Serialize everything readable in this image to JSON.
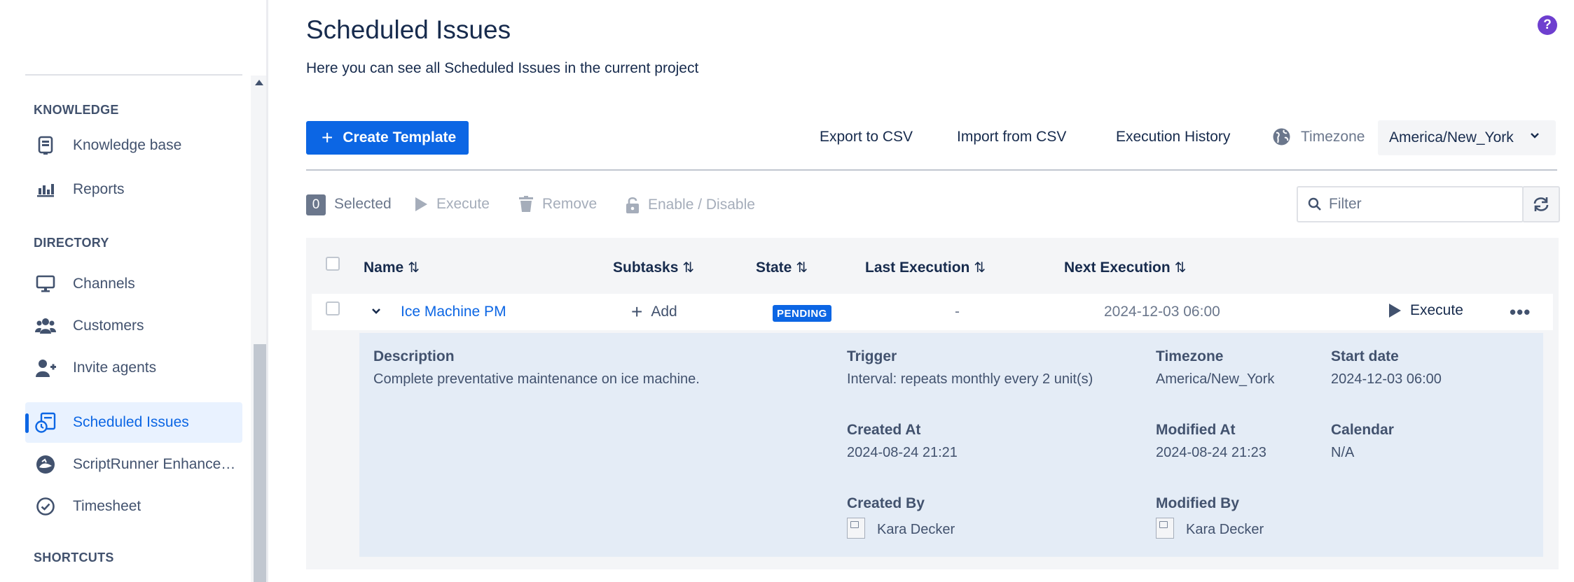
{
  "sidebar": {
    "sections": [
      {
        "heading": "KNOWLEDGE"
      },
      {
        "heading": "DIRECTORY"
      },
      {
        "heading": "SHORTCUTS"
      }
    ],
    "items": [
      {
        "label": "Knowledge base",
        "icon": "knowledge-base-icon"
      },
      {
        "label": "Reports",
        "icon": "bar-chart-icon"
      },
      {
        "label": "Channels",
        "icon": "monitor-icon"
      },
      {
        "label": "Customers",
        "icon": "people-icon"
      },
      {
        "label": "Invite agents",
        "icon": "person-add-icon"
      },
      {
        "label": "Scheduled Issues",
        "icon": "scheduled-clock-icon",
        "active": true
      },
      {
        "label": "ScriptRunner Enhanced...",
        "icon": "scriptrunner-icon"
      },
      {
        "label": "Timesheet",
        "icon": "check-circle-icon"
      }
    ]
  },
  "header": {
    "title": "Scheduled Issues",
    "description": "Here you can see all Scheduled Issues in the current project",
    "help_icon": "?"
  },
  "toolbar": {
    "create_label": "Create Template",
    "export_label": "Export to CSV",
    "import_label": "Import from CSV",
    "history_label": "Execution History",
    "timezone_label": "Timezone",
    "timezone_value": "America/New_York"
  },
  "bulk": {
    "selected_count": "0",
    "selected_label": "Selected",
    "execute_label": "Execute",
    "remove_label": "Remove",
    "enable_label": "Enable / Disable",
    "filter_placeholder": "Filter"
  },
  "table": {
    "columns": [
      "Name",
      "Subtasks",
      "State",
      "Last Execution",
      "Next Execution"
    ],
    "sort_glyph": "⇅",
    "rows": [
      {
        "name": "Ice Machine PM",
        "subtasks_action": "Add",
        "state": "PENDING",
        "last_execution": "-",
        "next_execution": "2024-12-03 06:00",
        "execute_label": "Execute",
        "more": "•••",
        "details": {
          "description_label": "Description",
          "description_value": "Complete preventative maintenance on ice machine.",
          "trigger_label": "Trigger",
          "trigger_value": "Interval: repeats monthly every 2 unit(s)",
          "timezone_label": "Timezone",
          "timezone_value": "America/New_York",
          "start_label": "Start date",
          "start_value": "2024-12-03 06:00",
          "created_at_label": "Created At",
          "created_at_value": "2024-08-24 21:21",
          "modified_at_label": "Modified At",
          "modified_at_value": "2024-08-24 21:23",
          "calendar_label": "Calendar",
          "calendar_value": "N/A",
          "created_by_label": "Created By",
          "created_by_value": "Kara Decker",
          "modified_by_label": "Modified By",
          "modified_by_value": "Kara Decker"
        }
      }
    ]
  },
  "colors": {
    "accent": "#0c66e4",
    "help": "#6e3fcf",
    "detail_bg": "#e4ecf6"
  }
}
